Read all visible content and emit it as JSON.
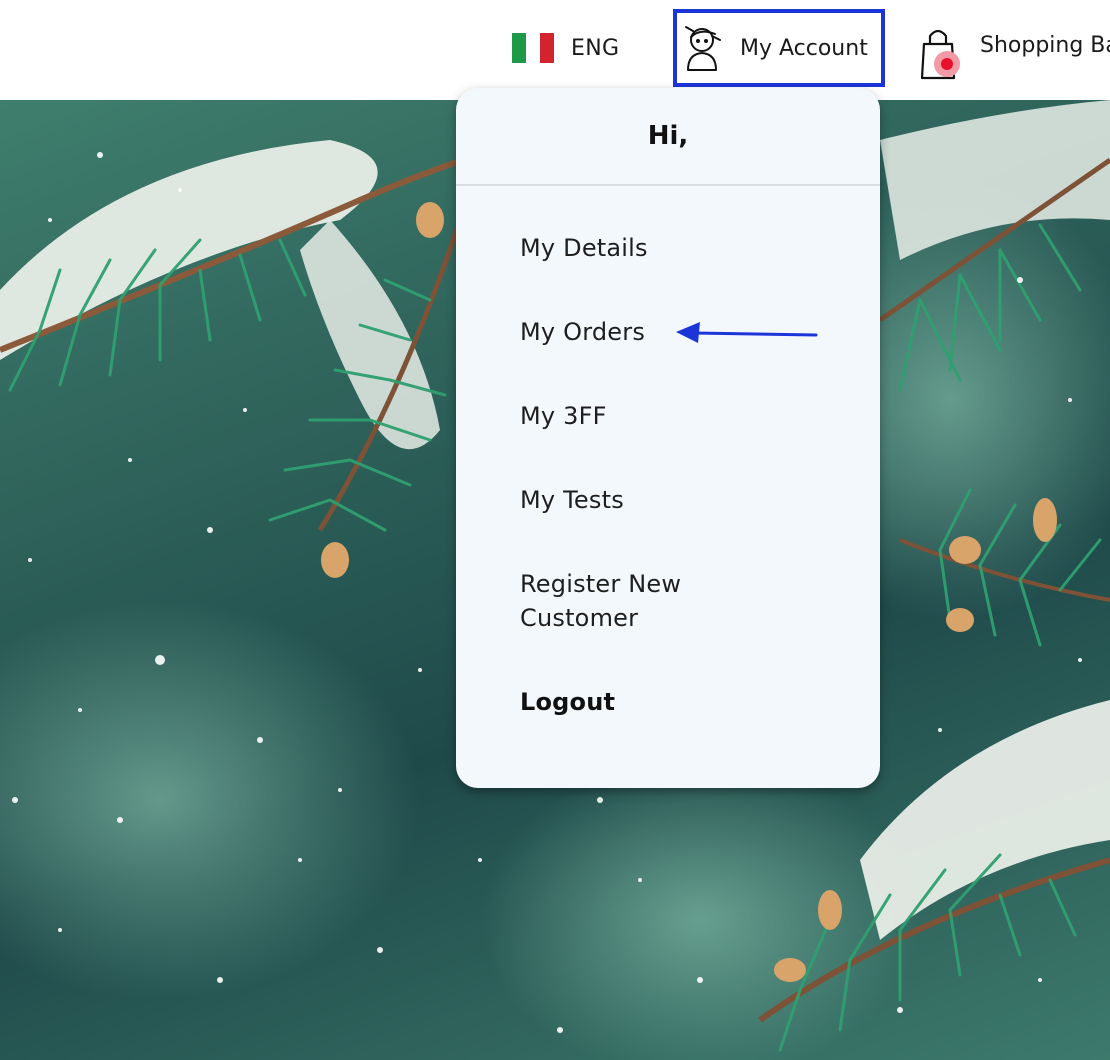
{
  "header": {
    "language": {
      "label": "ENG",
      "flag_colors": [
        "#1e9a46",
        "#ffffff",
        "#d2232f"
      ]
    },
    "account": {
      "label": "My Account",
      "icon": "user-avatar-icon",
      "highlight_color": "#1c35d8"
    },
    "bag": {
      "label": "Shopping Ba",
      "icon": "shopping-bag-icon",
      "badge_color": "#e8102b"
    }
  },
  "dropdown": {
    "greeting": "Hi,",
    "items": [
      {
        "label": "My Details"
      },
      {
        "label": "My Orders"
      },
      {
        "label": "My 3FF"
      },
      {
        "label": "My Tests"
      },
      {
        "label": "Register New Customer"
      },
      {
        "label": "Logout"
      }
    ]
  },
  "annotation": {
    "arrow_color": "#1c35d8",
    "points_to": "My Orders"
  }
}
